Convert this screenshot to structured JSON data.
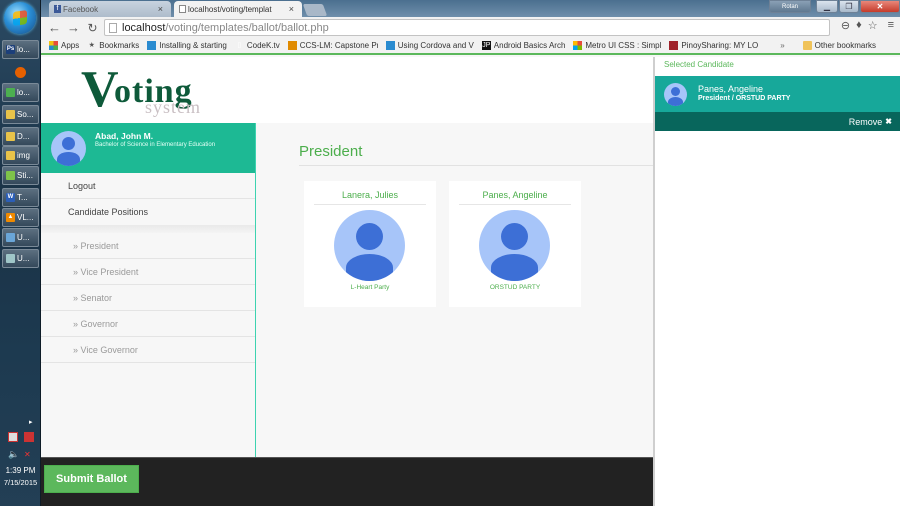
{
  "os": {
    "taskbar_items": [
      {
        "icon": "photoshop-icon",
        "label": "lo...",
        "color": "#1c3f7a",
        "glyph": "Ps"
      },
      {
        "icon": "firefox-icon",
        "label": "",
        "color": "#e66000",
        "glyph": ""
      },
      {
        "icon": "chrome-icon",
        "label": "lo...",
        "color": "#4caf50",
        "glyph": ""
      },
      {
        "icon": "folder-icon",
        "label": "So...",
        "color": "#e8c34a",
        "glyph": ""
      },
      {
        "icon": "folder-icon",
        "label": "D...",
        "color": "#e8c34a",
        "glyph": ""
      },
      {
        "icon": "folder-icon",
        "label": "img",
        "color": "#e8c34a",
        "glyph": ""
      },
      {
        "icon": "sticky-notes-icon",
        "label": "Sti...",
        "color": "#7ec34a",
        "glyph": ""
      },
      {
        "icon": "word-icon",
        "label": "T...",
        "color": "#2b5eb7",
        "glyph": "W"
      },
      {
        "icon": "vlc-icon",
        "label": "VL...",
        "color": "#f08a00",
        "glyph": "▲"
      },
      {
        "icon": "app-icon",
        "label": "U...",
        "color": "#6aa6d8",
        "glyph": ""
      },
      {
        "icon": "app-icon",
        "label": "U...",
        "color": "#9fc6c8",
        "glyph": ""
      }
    ],
    "clock_time": "1:39 PM",
    "clock_date": "7/15/2015"
  },
  "browser": {
    "tabs": [
      {
        "label": "Facebook",
        "icon": "facebook-icon"
      },
      {
        "label": "localhost/voting/templat",
        "icon": "page-icon"
      }
    ],
    "user_badge": "Rotan",
    "url_host": "localhost",
    "url_path": "/voting/templates/ballot/ballot.php",
    "bookmarks": [
      {
        "label": "Apps",
        "icon": "apps-icon",
        "color": "#e74c3c"
      },
      {
        "label": "Bookmarks",
        "icon": "star-icon",
        "color": "#555"
      },
      {
        "label": "Installing & starting",
        "icon": "wordpress-icon",
        "color": "#2a8bd0"
      },
      {
        "label": "CodeK.tv",
        "icon": "page-icon",
        "color": "#888"
      },
      {
        "label": "CCS-LM: Capstone Pr",
        "icon": "moodle-icon",
        "color": "#e08a00"
      },
      {
        "label": "Using Cordova and V",
        "icon": "cordova-icon",
        "color": "#2a8bd0"
      },
      {
        "label": "Android Basics Arch",
        "icon": "jp-icon",
        "color": "#111"
      },
      {
        "label": "Metro UI CSS : Simpl",
        "icon": "metro-icon",
        "color": "#e74c3c"
      },
      {
        "label": "PinoySharing: MY LO",
        "icon": "pinoy-icon",
        "color": "#a0222a"
      }
    ],
    "overflow": "»",
    "other_bookmarks": "Other bookmarks"
  },
  "app": {
    "logo_big": "V",
    "logo_rest": "oting",
    "logo_sub": "system",
    "user": {
      "name": "Abad, John M.",
      "course": "Bachelor of Science in Elementary Education"
    },
    "menu": {
      "logout": "Logout",
      "positions_header": "Candidate Positions",
      "positions": [
        "President",
        "Vice President",
        "Senator",
        "Governor",
        "Vice Governor"
      ]
    },
    "current_position": "President",
    "candidates": [
      {
        "name": "Lanera, Julies",
        "party": "L-Heart Party"
      },
      {
        "name": "Panes, Angeline",
        "party": "ORSTUD PARTY"
      }
    ],
    "submit_label": "Submit Ballot",
    "selected": {
      "label": "Selected Candidate",
      "name": "Panes, Angeline",
      "detail": "President / ORSTUD PARTY",
      "remove_label": "Remove"
    }
  }
}
